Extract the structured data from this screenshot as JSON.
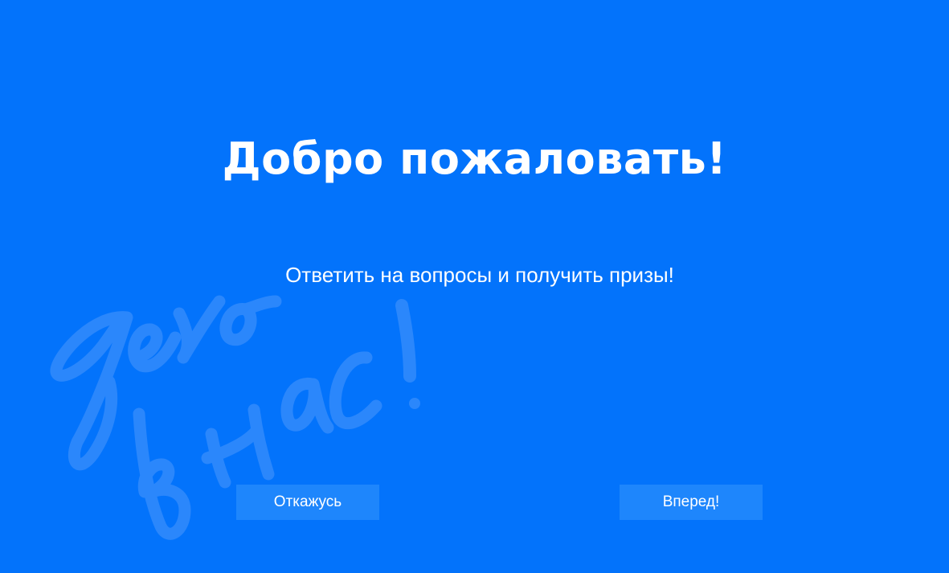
{
  "screen": {
    "title": "Добро пожаловать!",
    "subtitle": "Ответить на вопросы и получить призы!",
    "watermark_text": "дело в нас!"
  },
  "buttons": {
    "decline_label": "Откажусь",
    "next_label": "Вперед!"
  },
  "colors": {
    "background": "#0373fb",
    "button_background": "#1e86fc",
    "watermark": "#2b87fb",
    "text": "#ffffff"
  }
}
